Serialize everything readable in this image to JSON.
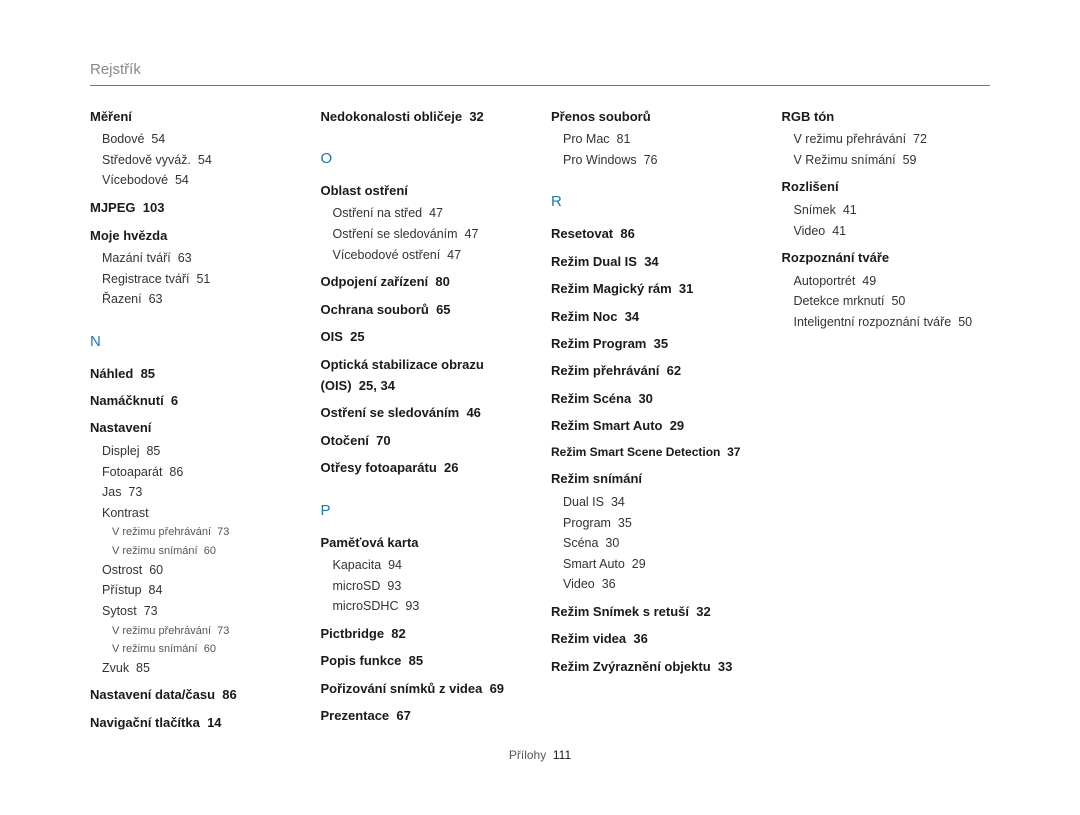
{
  "header": "Rejstřík",
  "footer": {
    "label": "Přílohy",
    "page": "111"
  },
  "letters": [
    "N",
    "O",
    "P",
    "R"
  ],
  "entries": [
    {
      "label": "Měření",
      "subs": [
        {
          "t": "Bodové",
          "p": "54"
        },
        {
          "t": "Středově vyváž.",
          "p": "54"
        },
        {
          "t": "Vícebodové",
          "p": "54"
        }
      ]
    },
    {
      "label": "MJPEG",
      "page": "103"
    },
    {
      "label": "Moje hvězda",
      "subs": [
        {
          "t": "Mazání tváří",
          "p": "63"
        },
        {
          "t": "Registrace tváří",
          "p": "51"
        },
        {
          "t": "Řazení",
          "p": "63"
        }
      ]
    },
    {
      "letter": 0
    },
    {
      "label": "Náhled",
      "page": "85"
    },
    {
      "label": "Namáčknutí",
      "page": "6"
    },
    {
      "label": "Nastavení",
      "subs": [
        {
          "t": "Displej",
          "p": "85"
        },
        {
          "t": "Fotoaparát",
          "p": "86"
        },
        {
          "t": "Jas",
          "p": "73"
        },
        {
          "t": "Kontrast",
          "subs": [
            {
              "t": "V režimu přehrávání",
              "p": "73"
            },
            {
              "t": "V režimu snímání",
              "p": "60"
            }
          ]
        },
        {
          "t": "Ostrost",
          "p": "60"
        },
        {
          "t": "Přístup",
          "p": "84"
        },
        {
          "t": "Sytost",
          "p": "73",
          "subs": [
            {
              "t": "V režimu přehrávání",
              "p": "73"
            },
            {
              "t": "V režimu snímání",
              "p": "60"
            }
          ]
        },
        {
          "t": "Zvuk",
          "p": "85"
        }
      ]
    },
    {
      "label": "Nastavení data/času",
      "page": "86"
    },
    {
      "label": "Navigační tlačítka",
      "page": "14"
    },
    {
      "label": "Nedokonalosti obličeje",
      "page": "32"
    },
    {
      "letter": 1
    },
    {
      "label": "Oblast ostření",
      "subs": [
        {
          "t": "Ostření na střed",
          "p": "47"
        },
        {
          "t": "Ostření se sledováním",
          "p": "47"
        },
        {
          "t": "Vícebodové ostření",
          "p": "47"
        }
      ]
    },
    {
      "label": "Odpojení zařízení",
      "page": "80"
    },
    {
      "label": "Ochrana souborů",
      "page": "65"
    },
    {
      "label": "OIS",
      "page": "25"
    },
    {
      "label": "Optická stabilizace obrazu (OIS)",
      "page": "25, 34"
    },
    {
      "label": "Ostření se sledováním",
      "page": "46"
    },
    {
      "label": "Otočení",
      "page": "70"
    },
    {
      "label": "Otřesy fotoaparátu",
      "page": "26"
    },
    {
      "letter": 2
    },
    {
      "label": "Paměťová karta",
      "subs": [
        {
          "t": "Kapacita",
          "p": "94"
        },
        {
          "t": "microSD",
          "p": "93"
        },
        {
          "t": "microSDHC",
          "p": "93"
        }
      ]
    },
    {
      "label": "Pictbridge",
      "page": "82"
    },
    {
      "label": "Popis funkce",
      "page": "85"
    },
    {
      "label": "Pořizování snímků z videa",
      "page": "69"
    },
    {
      "label": "Prezentace",
      "page": "67"
    },
    {
      "label": "Přenos souborů",
      "subs": [
        {
          "t": "Pro Mac",
          "p": "81"
        },
        {
          "t": "Pro Windows",
          "p": "76"
        }
      ]
    },
    {
      "letter": 3
    },
    {
      "label": "Resetovat",
      "page": "86"
    },
    {
      "label": "Režim Dual IS",
      "page": "34"
    },
    {
      "label": "Režim Magický rám",
      "page": "31"
    },
    {
      "label": "Režim Noc",
      "page": "34"
    },
    {
      "label": "Režim Program",
      "page": "35"
    },
    {
      "label": "Režim přehrávání",
      "page": "62"
    },
    {
      "label": "Režim Scéna",
      "page": "30"
    },
    {
      "label": "Režim Smart Auto",
      "page": "29"
    },
    {
      "label": "Režim Smart Scene Detection",
      "page": "37",
      "small": true
    },
    {
      "label": "Režim snímání",
      "subs": [
        {
          "t": "Dual IS",
          "p": "34"
        },
        {
          "t": "Program",
          "p": "35"
        },
        {
          "t": "Scéna",
          "p": "30"
        },
        {
          "t": "Smart Auto",
          "p": "29"
        },
        {
          "t": "Video",
          "p": "36"
        }
      ]
    },
    {
      "label": "Režim Snímek s retuší",
      "page": "32"
    },
    {
      "label": "Režim videa",
      "page": "36"
    },
    {
      "label": "Režim Zvýraznění objektu",
      "page": "33"
    },
    {
      "label": "RGB tón",
      "subs": [
        {
          "t": "V režimu přehrávání",
          "p": "72"
        },
        {
          "t": "V Režimu snímání",
          "p": "59"
        }
      ]
    },
    {
      "label": "Rozlišení",
      "subs": [
        {
          "t": "Snímek",
          "p": "41"
        },
        {
          "t": "Video",
          "p": "41"
        }
      ]
    },
    {
      "label": "Rozpoznání tváře",
      "subs": [
        {
          "t": "Autoportrét",
          "p": "49"
        },
        {
          "t": "Detekce mrknutí",
          "p": "50"
        },
        {
          "t": "Inteligentní rozpoznání tváře",
          "p": "50"
        }
      ]
    }
  ]
}
